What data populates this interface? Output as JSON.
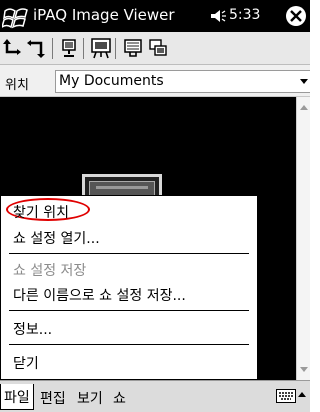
{
  "titlebar": {
    "title": "iPAQ Image Viewer",
    "time": "5:33",
    "icons": [
      "windows-flag-icon",
      "speaker-icon",
      "close-icon"
    ]
  },
  "toolbar": {
    "buttons": [
      "rotate-left-icon",
      "rotate-right-icon",
      "full-screen-icon",
      "slideshow-icon",
      "display-icon",
      "copy-icon"
    ]
  },
  "location": {
    "label": "위치",
    "value": "My Documents"
  },
  "menu": {
    "items": [
      {
        "label": "찾기 위치",
        "enabled": true,
        "highlighted": true
      },
      {
        "label": "쇼 설정 열기...",
        "enabled": true
      },
      {
        "label": "쇼 설정 저장",
        "enabled": false
      },
      {
        "label": "다른 이름으로 쇼 설정 저장...",
        "enabled": true
      },
      {
        "label": "정보...",
        "enabled": true
      },
      {
        "label": "닫기",
        "enabled": true
      }
    ]
  },
  "menubar": {
    "items": [
      "파일",
      "편집",
      "보기",
      "쇼"
    ],
    "active": "파일"
  },
  "colors": {
    "titlebar": "#000000",
    "highlight": "#e00000",
    "disabled_text": "#8c8c8c"
  }
}
